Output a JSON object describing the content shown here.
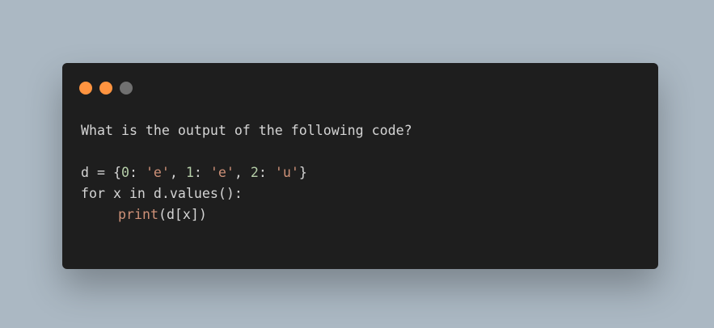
{
  "colors": {
    "background": "#abb8c3",
    "window": "#1e1e1e",
    "dot_close": "#ff9440",
    "dot_minimize": "#ff9440",
    "dot_zoom": "#707070",
    "text": "#d4d4d4",
    "number": "#b5cea8",
    "string": "#ce9178"
  },
  "window": {
    "dots": [
      "close-dot",
      "minimize-dot",
      "zoom-dot"
    ]
  },
  "code": {
    "question": "What is the output of the following code?",
    "line2": {
      "t1": "d = {",
      "n0": "0",
      "t2": ": ",
      "s0": "'e'",
      "t3": ", ",
      "n1": "1",
      "t4": ": ",
      "s1": "'e'",
      "t5": ", ",
      "n2": "2",
      "t6": ": ",
      "s2": "'u'",
      "t7": "}"
    },
    "line3": "for x in d.values():",
    "line4": {
      "fn": "print",
      "rest": "(d[x])"
    }
  }
}
